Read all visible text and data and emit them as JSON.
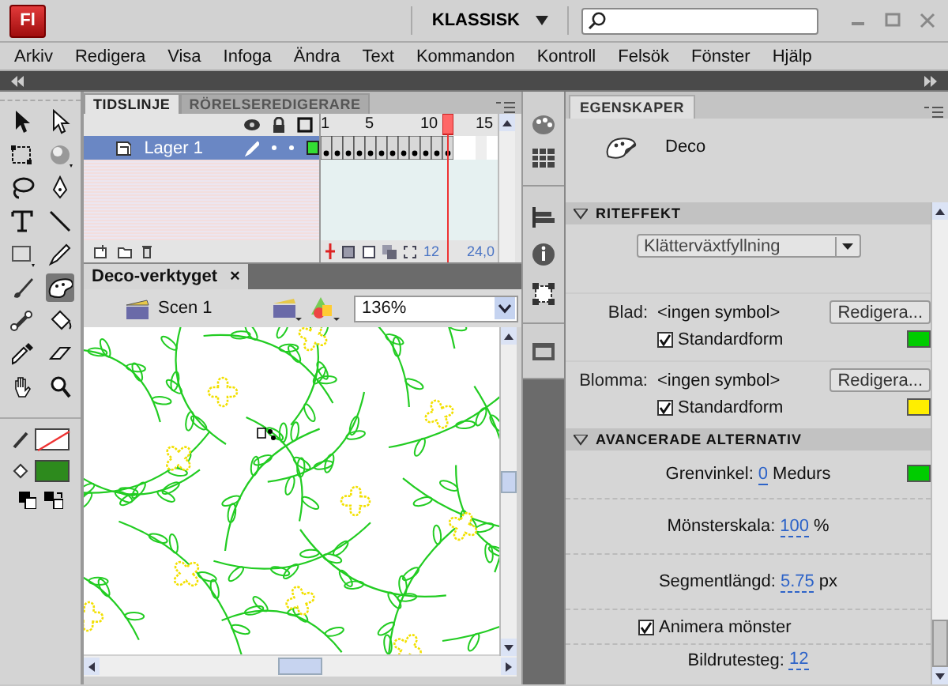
{
  "app": {
    "logo": "Fl",
    "workspace": "KLASSISK"
  },
  "menu": [
    "Arkiv",
    "Redigera",
    "Visa",
    "Infoga",
    "Ändra",
    "Text",
    "Kommandon",
    "Kontroll",
    "Felsök",
    "Fönster",
    "Hjälp"
  ],
  "tools": [
    {
      "kind": "arrow",
      "selected": false
    },
    {
      "kind": "subarrow",
      "selected": false
    },
    {
      "kind": "transform",
      "selected": false
    },
    {
      "kind": "rotate3d",
      "selected": false
    },
    {
      "kind": "lasso",
      "selected": false
    },
    {
      "kind": "pen",
      "selected": false
    },
    {
      "kind": "text",
      "selected": false
    },
    {
      "kind": "line",
      "selected": false
    },
    {
      "kind": "rect",
      "selected": false
    },
    {
      "kind": "pencil",
      "selected": false
    },
    {
      "kind": "brush",
      "selected": false
    },
    {
      "kind": "deco",
      "selected": true
    },
    {
      "kind": "bone",
      "selected": false
    },
    {
      "kind": "bucket",
      "selected": false
    },
    {
      "kind": "eyedropper",
      "selected": false
    },
    {
      "kind": "eraser",
      "selected": false
    },
    {
      "kind": "hand",
      "selected": false
    },
    {
      "kind": "zoom",
      "selected": false
    }
  ],
  "timeline": {
    "tabs": [
      {
        "label": "TIDSLINJE",
        "selected": true
      },
      {
        "label": "RÖRELSEREDIGERARE",
        "selected": false
      }
    ],
    "frame_numbers": [
      "1",
      "5",
      "10",
      "15"
    ],
    "layers": [
      {
        "name": "Lager 1",
        "selected": true,
        "color": "#33dd33"
      }
    ],
    "current_frame": "12",
    "frame_rate": "24,0"
  },
  "document": {
    "tab": "Deco-verktyget",
    "close": "×",
    "scene": "Scen 1",
    "zoom": "136%"
  },
  "properties": {
    "tab": "EGENSKAPER",
    "tool": "Deco",
    "effect": {
      "title": "RITEFFEKT",
      "expanded": true,
      "choice": "Klätterväxtfyllning",
      "items": [
        {
          "label": "Blad:",
          "value": "<ingen symbol>",
          "button": "Redigera...",
          "option": "Standardform",
          "checked": true,
          "color": "#00cc00"
        },
        {
          "label": "Blomma:",
          "value": "<ingen symbol>",
          "button": "Redigera...",
          "option": "Standardform",
          "checked": true,
          "color": "#ffee00"
        }
      ]
    },
    "advanced": {
      "title": "AVANCERADE ALTERNATIV",
      "expanded": true,
      "rows": [
        {
          "kind": "value",
          "label": "Grenvinkel:",
          "value": "0",
          "unit": "Medurs",
          "color": "#00cc00"
        },
        {
          "kind": "value",
          "label": "Mönsterskala:",
          "value": "100",
          "unit": "%"
        },
        {
          "kind": "value",
          "label": "Segmentlängd:",
          "value": "5.75",
          "unit": "px"
        },
        {
          "kind": "checkbox",
          "label": "Animera mönster",
          "checked": true
        },
        {
          "kind": "value",
          "label": "Bildrutesteg:",
          "value": "12"
        }
      ]
    }
  }
}
